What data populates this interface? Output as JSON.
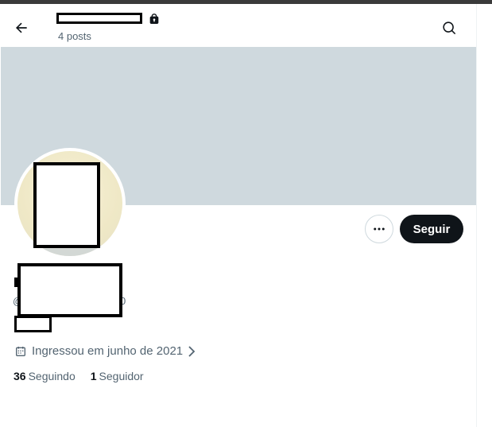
{
  "header": {
    "posts_count": "4 posts"
  },
  "icons": {
    "back": "back-arrow-icon",
    "lock": "lock-icon",
    "search": "search-icon",
    "more": "more-icon",
    "calendar": "calendar-icon",
    "chevron": "chevron-right-icon"
  },
  "actions": {
    "follow_label": "Seguir"
  },
  "profile": {
    "handle_left_glyph": "@",
    "handle_right_glyph": "0",
    "joined_text": "Ingressou em junho de 2021"
  },
  "stats": {
    "following_count": "36",
    "following_label": "Seguindo",
    "followers_count": "1",
    "followers_label": "Seguidor"
  },
  "colors": {
    "banner": "#cfd9de",
    "primary_button": "#0f1419",
    "secondary_text": "#536471"
  }
}
